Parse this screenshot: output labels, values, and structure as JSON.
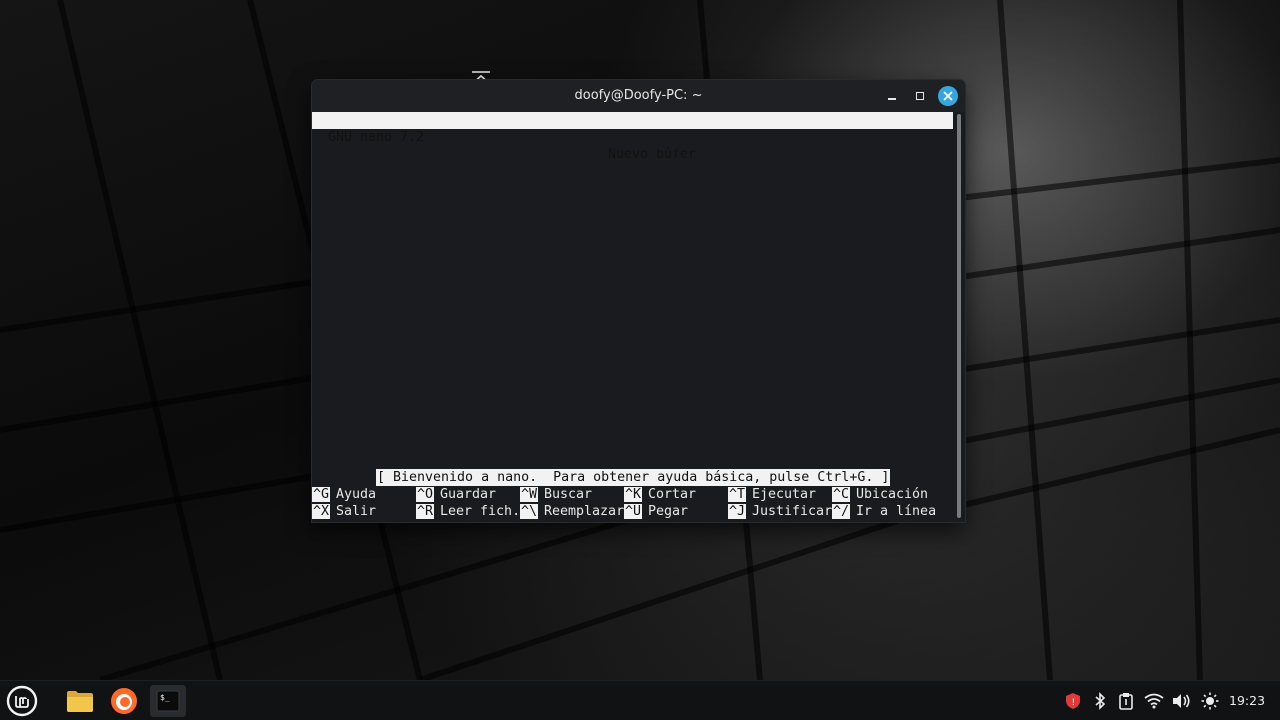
{
  "window": {
    "title": "doofy@Doofy-PC: ~"
  },
  "nano": {
    "version_label": "GNU nano 7.2",
    "buffer_label": "Nuevo búfer",
    "status_message": "[ Bienvenido a nano.  Para obtener ayuda básica, pulse Ctrl+G. ]",
    "shortcuts_row1": [
      {
        "key": "^G",
        "label": "Ayuda"
      },
      {
        "key": "^O",
        "label": "Guardar"
      },
      {
        "key": "^W",
        "label": "Buscar"
      },
      {
        "key": "^K",
        "label": "Cortar"
      },
      {
        "key": "^T",
        "label": "Ejecutar"
      },
      {
        "key": "^C",
        "label": "Ubicación"
      }
    ],
    "shortcuts_row2": [
      {
        "key": "^X",
        "label": "Salir"
      },
      {
        "key": "^R",
        "label": "Leer fich."
      },
      {
        "key": "^\\",
        "label": "Reemplazar"
      },
      {
        "key": "^U",
        "label": "Pegar"
      },
      {
        "key": "^J",
        "label": "Justificar"
      },
      {
        "key": "^/",
        "label": "Ir a línea"
      }
    ]
  },
  "taskbar": {
    "apps": [
      "menu-icon",
      "files-icon",
      "firefox-icon",
      "terminal-icon"
    ],
    "clock": "19:23",
    "colors": {
      "close_button": "#35a7dd",
      "firefox": "#ff6a2b",
      "folder": "#f2c64b"
    }
  }
}
